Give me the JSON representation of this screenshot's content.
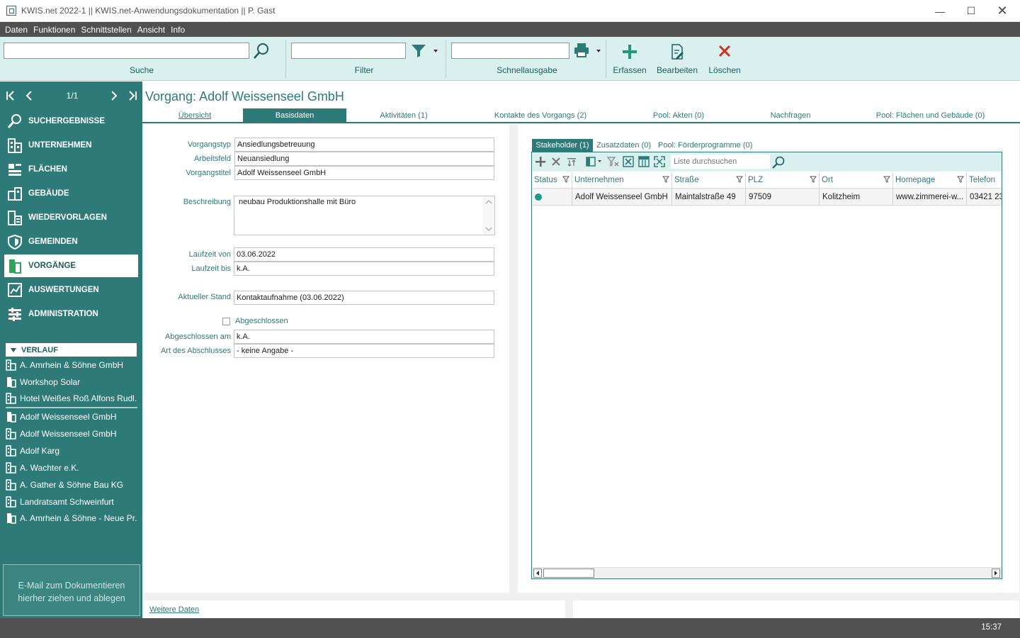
{
  "window": {
    "title": "KWIS.net 2022-1 || KWIS.net-Anwendungsdokumentation || P. Gast"
  },
  "menu": [
    "Daten",
    "Funktionen",
    "Schnittstellen",
    "Ansicht",
    "Info"
  ],
  "toolbar": {
    "search_label": "Suche",
    "filter_label": "Filter",
    "quickout_label": "Schnellausgabe",
    "create_label": "Erfassen",
    "edit_label": "Bearbeiten",
    "delete_label": "Löschen"
  },
  "pager": {
    "counter": "1/1"
  },
  "nav": [
    {
      "label": "SUCHERGEBNISSE",
      "icon": "search-icon"
    },
    {
      "label": "UNTERNEHMEN",
      "icon": "building-icon"
    },
    {
      "label": "FLÄCHEN",
      "icon": "area-icon"
    },
    {
      "label": "GEBÄUDE",
      "icon": "house-icon"
    },
    {
      "label": "WIEDERVORLAGEN",
      "icon": "calendar-icon"
    },
    {
      "label": "GEMEINDEN",
      "icon": "shield-icon"
    },
    {
      "label": "VORGÄNGE",
      "icon": "folder-icon",
      "active": true
    },
    {
      "label": "AUSWERTUNGEN",
      "icon": "chart-icon"
    },
    {
      "label": "ADMINISTRATION",
      "icon": "settings-icon"
    }
  ],
  "history": {
    "title": "VERLAUF",
    "items": [
      "A. Amrhein & Söhne GmbH",
      "Workshop Solar",
      "Hotel Weißes Roß Alfons Rudl...",
      "Adolf Weissenseel GmbH",
      "Adolf Weissenseel GmbH",
      "Adolf Karg",
      "A. Wachter e.K.",
      "A. Gather & Söhne Bau KG",
      "Landratsamt Schweinfurt",
      "A. Amrhein & Söhne - Neue Pr..."
    ]
  },
  "dropzone": {
    "line1": "E-Mail  zum Dokumentieren",
    "line2": "hierher ziehen und ablegen"
  },
  "record": {
    "title": "Vorgang: Adolf Weissenseel GmbH"
  },
  "tabs": [
    "Übersicht",
    "Basisdaten",
    "Aktivitäten (1)",
    "Kontakte des Vorgangs (2)",
    "Pool: Akten (0)",
    "Nachfragen",
    "Pool: Flächen und Gebäude (0)"
  ],
  "form": {
    "vorgangstyp_label": "Vorgangstyp",
    "vorgangstyp": "Ansiedlungsbetreuung",
    "arbeitsfeld_label": "Arbeitsfeld",
    "arbeitsfeld": "Neuansiedlung",
    "vorgangstitel_label": "Vorgangstitel",
    "vorgangstitel": "Adolf Weissenseel GmbH",
    "beschreibung_label": "Beschreibung",
    "beschreibung": "neubau Produktionshalle mit Büro",
    "laufzeit_von_label": "Laufzeit von",
    "laufzeit_von": "03.06.2022",
    "laufzeit_bis_label": "Laufzeit bis",
    "laufzeit_bis": "k.A.",
    "stand_label": "Aktueller Stand",
    "stand": "Kontaktaufnahme (03.06.2022)",
    "abgeschlossen_label": "Abgeschlossen",
    "abgeschlossen_am_label": "Abgeschlossen am",
    "abgeschlossen_am": "k.A.",
    "art_label": "Art des Abschlusses",
    "art": "- keine Angabe -"
  },
  "subtabs": [
    "Stakeholder (1)",
    "Zusatzdaten (0)",
    "Pool: Förderprogramme (0)"
  ],
  "grid": {
    "search_placeholder": "Liste durchsuchen",
    "columns": [
      "Status",
      "Unternehmen",
      "Straße",
      "PLZ",
      "Ort",
      "Homepage",
      "Telefon"
    ],
    "rows": [
      {
        "unternehmen": "Adolf Weissenseel GmbH",
        "strasse": "Maintalstraße 49",
        "plz": "97509",
        "ort": "Kolitzheim",
        "homepage": "www.zimmerei-w...",
        "telefon": "03421 23"
      }
    ],
    "status_color": "#1e9a8c"
  },
  "footer": {
    "more_link": "Weitere Daten"
  },
  "status": {
    "clock": "15:37"
  },
  "colors": {
    "accent": "#2e7a78",
    "toolbar_bg": "#daf0ee",
    "delete_red": "#d32f1f"
  }
}
